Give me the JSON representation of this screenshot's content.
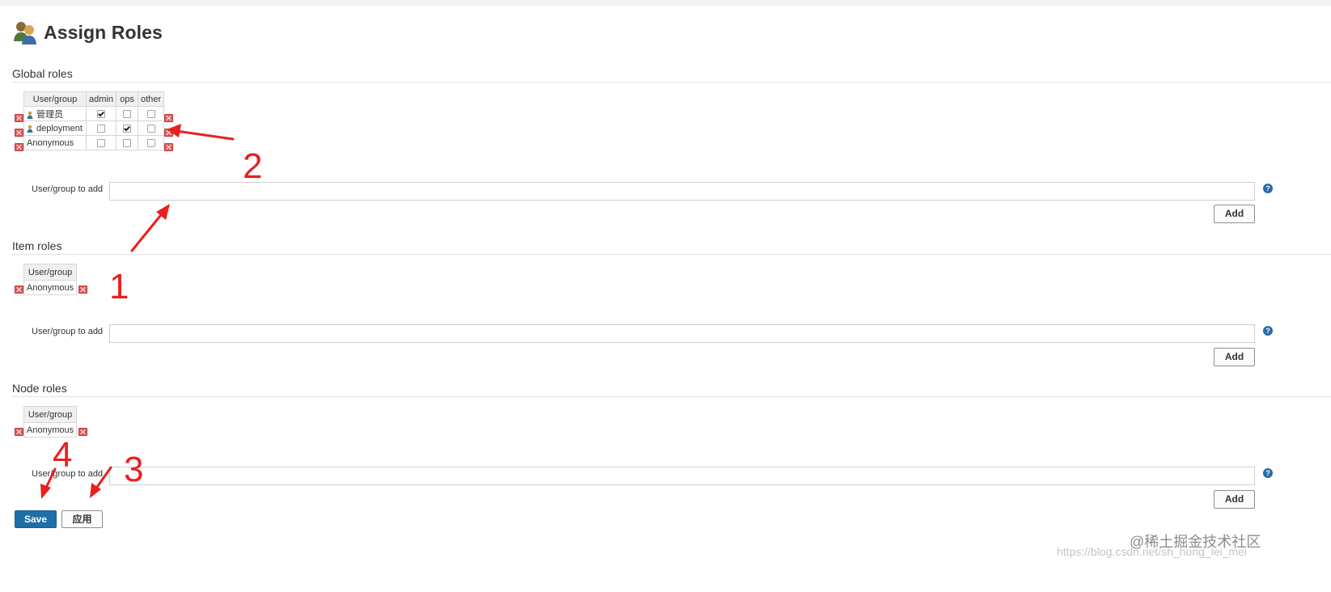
{
  "page": {
    "title": "Assign Roles",
    "title_icon": "users-icon"
  },
  "global_roles": {
    "heading": "Global roles",
    "columns": [
      "User/group",
      "admin",
      "ops",
      "other"
    ],
    "rows": [
      {
        "name": "管理员",
        "user_icon": true,
        "checks": [
          true,
          false,
          false
        ]
      },
      {
        "name": "deployment",
        "user_icon": true,
        "checks": [
          false,
          true,
          false
        ]
      },
      {
        "name": "Anonymous",
        "user_icon": false,
        "checks": [
          false,
          false,
          false
        ]
      }
    ],
    "add_label": "User/group to add",
    "add_value": "",
    "add_button": "Add"
  },
  "item_roles": {
    "heading": "Item roles",
    "columns": [
      "User/group"
    ],
    "rows": [
      {
        "name": "Anonymous"
      }
    ],
    "add_label": "User/group to add",
    "add_value": "",
    "add_button": "Add"
  },
  "node_roles": {
    "heading": "Node roles",
    "columns": [
      "User/group"
    ],
    "rows": [
      {
        "name": "Anonymous"
      }
    ],
    "add_label": "User/group to add",
    "add_value": "",
    "add_button": "Add"
  },
  "footer": {
    "save_label": "Save",
    "apply_label": "应用"
  },
  "annotations": {
    "labels": [
      "1",
      "2",
      "3",
      "4"
    ],
    "color": "#e8201f"
  },
  "watermark": {
    "text": "@稀土掘金技术社区",
    "url": "https://blog.csdn.net/sh_hong_lei_mei"
  },
  "colors": {
    "primary_button": "#1e6ea7",
    "help_icon": "#2a6aa8",
    "delete_icon": "#e05c5c"
  }
}
